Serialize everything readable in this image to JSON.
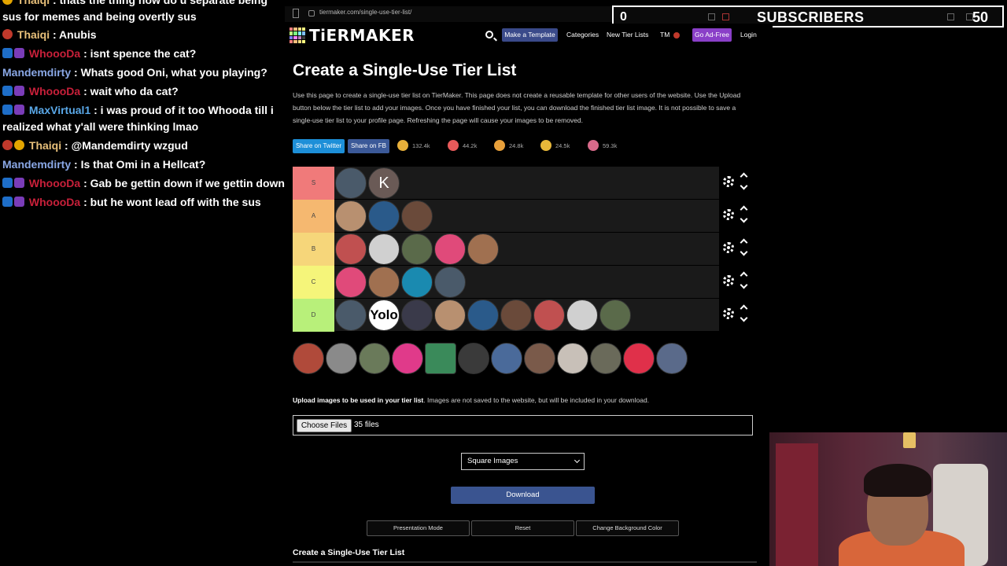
{
  "chat": {
    "messages": [
      {
        "user": "Thaiqi",
        "text": " : thats the thing how do u separate being sus for memes and being overtly sus"
      },
      {
        "user": "Thaiqi",
        "text": " : Anubis"
      },
      {
        "user": "WhoooDa",
        "text": " : isnt spence the cat?"
      },
      {
        "user": "Mandemdirty",
        "text": " : Whats good Oni, what you playing?"
      },
      {
        "user": "WhoooDa",
        "text": " : wait who da cat?"
      },
      {
        "user": "MaxVirtual1",
        "text": " : i was proud of it too Whooda till i realized what y'all were thinking lmao"
      },
      {
        "user": "Thaiqi",
        "text": " : @Mandemdirty wzgud"
      },
      {
        "user": "Mandemdirty",
        "text": " : Is that Omi in a Hellcat?"
      },
      {
        "user": "WhoooDa",
        "text": " : Gab be gettin down if we gettin down"
      },
      {
        "user": "WhoooDa",
        "text": " : but he wont lead off with the sus"
      }
    ]
  },
  "browser": {
    "url": "tiermaker.com/single-use-tier-list/"
  },
  "overlay": {
    "left_count": "0",
    "label": "SUBSCRIBERS",
    "right_count": "50"
  },
  "nav": {
    "logo": "TiERMAKER",
    "make_template": "Make a Template",
    "categories": "Categories",
    "new_tier_lists": "New Tier Lists",
    "tm": "TM",
    "go_ad_free": "Go Ad-Free",
    "login": "Login"
  },
  "page": {
    "title": "Create a Single-Use Tier List",
    "intro": "Use this page to create a single-use tier list on TierMaker. This page does not create a reusable template for other users of the website. Use the Upload button below the tier list to add your images. Once you have finished your list, you can download the finished tier list image. It is not possible to save a single-use tier list to your profile page. Refreshing the page will cause your images to be removed.",
    "share_twitter": "Share on Twitter",
    "share_fb": "Share on FB",
    "reactions": [
      {
        "icon": "laughing-face-icon",
        "count": "132.4k",
        "color": "#e8b03a"
      },
      {
        "icon": "heart-eyes-icon",
        "count": "44.2k",
        "color": "#e85a5a"
      },
      {
        "icon": "grin-icon",
        "count": "24.8k",
        "color": "#e8a03a"
      },
      {
        "icon": "raised-hands-icon",
        "count": "24.5k",
        "color": "#e8b83a"
      },
      {
        "icon": "poop-icon",
        "count": "59.3k",
        "color": "#d86a8a"
      }
    ],
    "tiers": [
      {
        "label": "S",
        "color": "#f07a7a",
        "items": 2
      },
      {
        "label": "A",
        "color": "#f5b870",
        "items": 3
      },
      {
        "label": "B",
        "color": "#f6d67a",
        "items": 5
      },
      {
        "label": "C",
        "color": "#f5f57a",
        "items": 4
      },
      {
        "label": "D",
        "color": "#b8f07a",
        "items": 9
      }
    ],
    "tier_s_letter": "K",
    "tier_d_text": "Yolo",
    "upload_bold": "Upload images to be used in your tier list",
    "upload_rest": ". Images are not saved to the website, but will be included in your download.",
    "choose_files": "Choose Files",
    "file_count": "35 files",
    "shape_select": "Square Images",
    "download": "Download",
    "presentation_mode": "Presentation Mode",
    "reset": "Reset",
    "change_bg": "Change Background Color",
    "footer_title": "Create a Single-Use Tier List"
  },
  "colors": {
    "avatars": [
      "#4a5a6a",
      "#8a6a5a",
      "#3a3a4a",
      "#b89070",
      "#2a5a8a",
      "#6a4a3a",
      "#c05050",
      "#d0d0d0",
      "#5a6a4a",
      "#e04a7a",
      "#a07050",
      "#1a8ab0"
    ]
  }
}
